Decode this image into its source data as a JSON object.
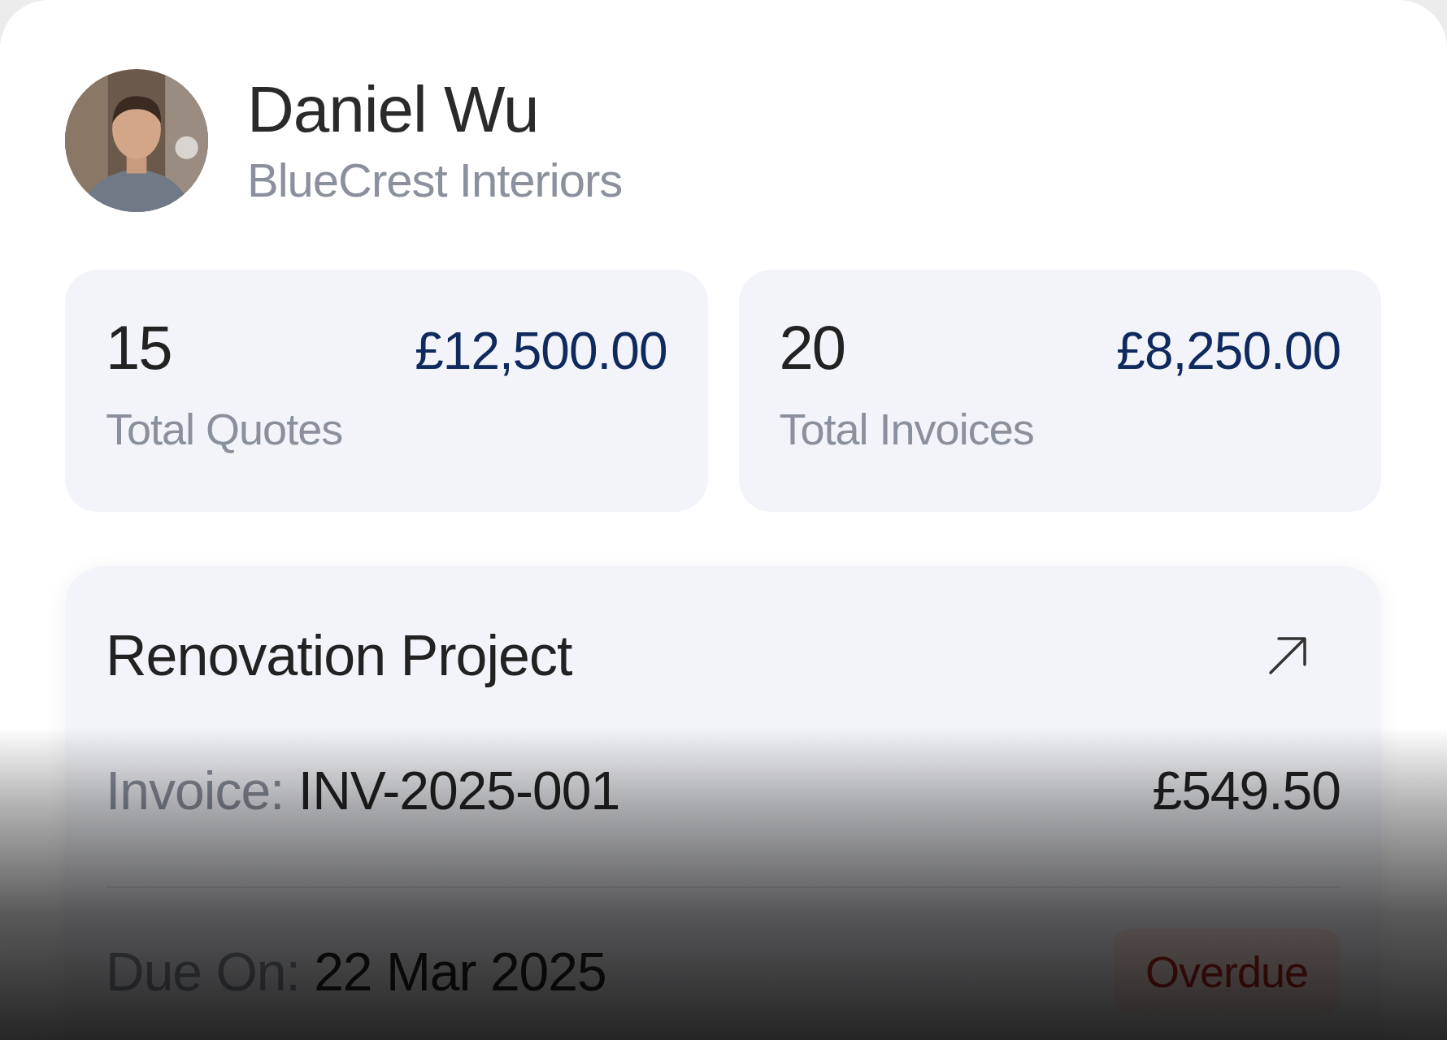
{
  "profile": {
    "name": "Daniel Wu",
    "company": "BlueCrest Interiors"
  },
  "stats": [
    {
      "count": "15",
      "amount": "£12,500.00",
      "label": "Total Quotes"
    },
    {
      "count": "20",
      "amount": "£8,250.00",
      "label": "Total Invoices"
    }
  ],
  "project": {
    "title": "Renovation Project",
    "invoice_label": "Invoice:",
    "invoice_number": "INV-2025-001",
    "amount": "£549.50",
    "due_label": "Due On:",
    "due_date": "22 Mar 2025",
    "status": {
      "label": "Overdue",
      "kind": "overdue"
    }
  }
}
